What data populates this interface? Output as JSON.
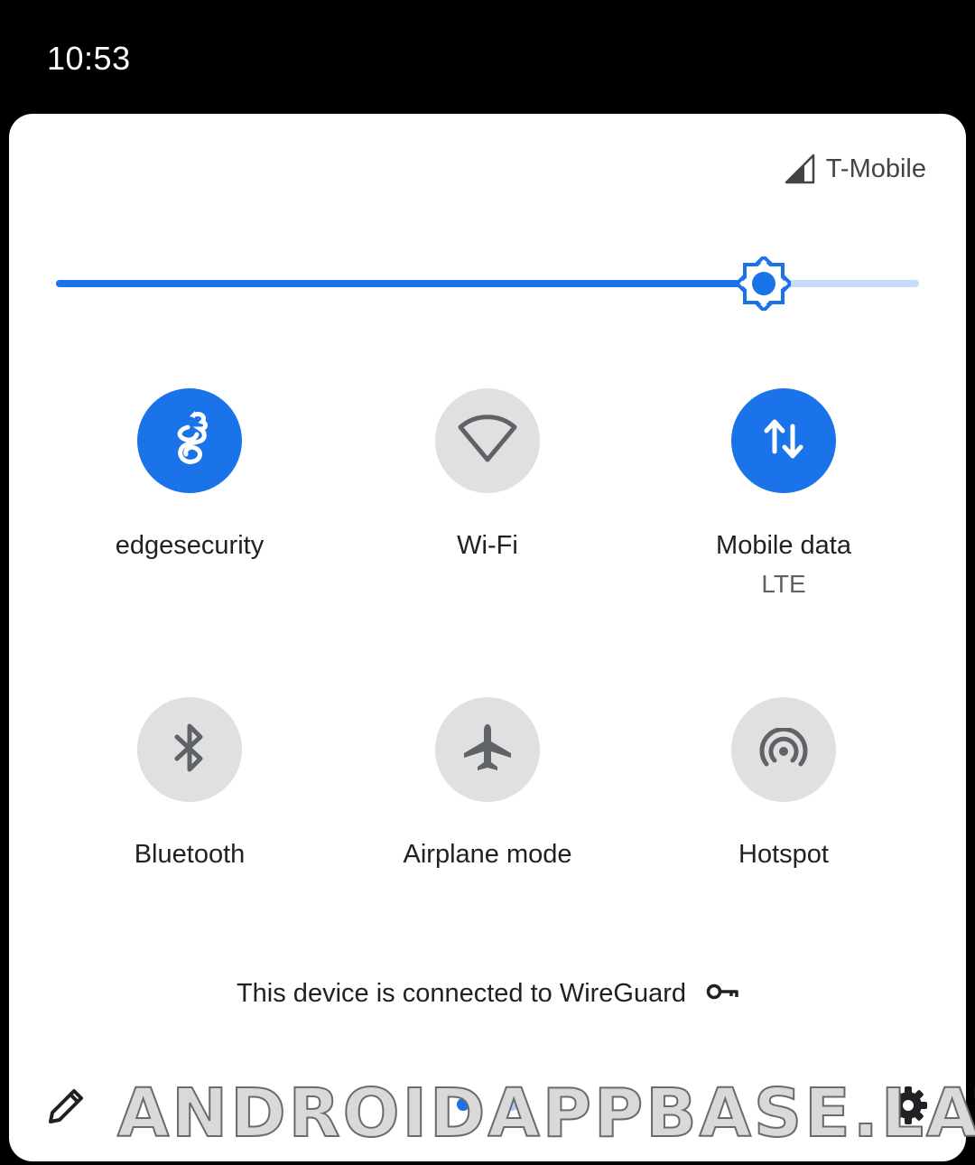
{
  "status_bar": {
    "time": "10:53"
  },
  "header": {
    "carrier": "T-Mobile",
    "signal_icon": "cell-signal-icon"
  },
  "brightness": {
    "level_fraction": 0.82,
    "icon": "brightness-icon",
    "accent": "#1a73e8",
    "track_color": "#c6dafc"
  },
  "tiles": [
    {
      "label": "edgesecurity",
      "sublabel": "",
      "state": "on",
      "icon": "wireguard-dragon-icon"
    },
    {
      "label": "Wi-Fi",
      "sublabel": "",
      "state": "off",
      "icon": "wifi-icon"
    },
    {
      "label": "Mobile data",
      "sublabel": "LTE",
      "state": "on",
      "icon": "data-arrows-icon"
    },
    {
      "label": "Bluetooth",
      "sublabel": "",
      "state": "off",
      "icon": "bluetooth-icon"
    },
    {
      "label": "Airplane mode",
      "sublabel": "",
      "state": "off",
      "icon": "airplane-icon"
    },
    {
      "label": "Hotspot",
      "sublabel": "",
      "state": "off",
      "icon": "hotspot-icon"
    }
  ],
  "footer": {
    "vpn_message": "This device is connected to WireGuard",
    "vpn_icon": "key-icon"
  },
  "bottom": {
    "edit_icon": "pencil-icon",
    "settings_icon": "gear-icon",
    "pages": 2,
    "active_page": 1
  },
  "watermark": {
    "text": "ANDROIDAPPBASE.LAT"
  },
  "colors": {
    "on": "#1a73e8",
    "off": "#e0e0e0",
    "icon_off": "#5f6368"
  }
}
